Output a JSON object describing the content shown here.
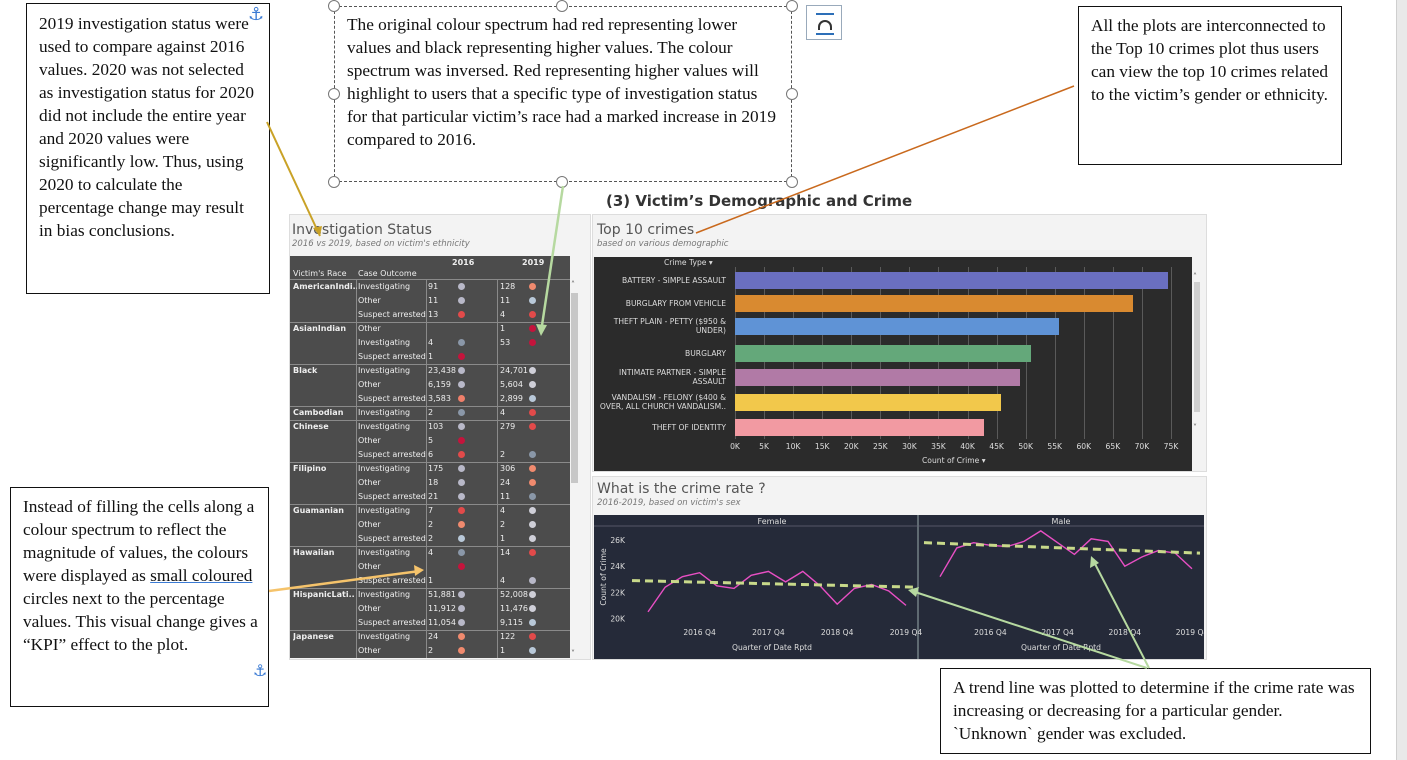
{
  "callouts": {
    "left": "2019 investigation status were used to compare against 2016 values. 2020 was not selected as investigation status for 2020 did not include the entire year and 2020 values were significantly low. Thus, using 2020 to calculate the percentage change may result in bias conclusions.",
    "center": "The original colour spectrum had red representing lower values and black representing higher values. The colour spectrum was inversed. Red representing higher values will highlight to users that a specific type of investigation status for that particular victim’s race had a marked increase in 2019 compared to 2016.",
    "right": "All the plots are interconnected to the Top 10 crimes plot thus users can view the top 10 crimes related to the victim’s gender or ethnicity.",
    "bottom_left_pre": "Instead of filling the cells along a colour spectrum to reflect the magnitude of values, the colours were displayed as ",
    "bottom_left_link": "small coloured",
    "bottom_left_post": " circles next to the percentage values. This visual change gives a “KPI” effect to the plot.",
    "bottom_right": "A trend line was plotted to determine if the crime rate was increasing or decreasing for a particular gender. `Unknown` gender was excluded."
  },
  "section_title": "(3) Victim’s Demographic and Crime",
  "investigation": {
    "title": "Investigation Status",
    "subtitle": "2016 vs 2019, based on victim's ethnicity",
    "col_race": "Victim's Race",
    "col_outcome": "Case Outcome",
    "col_2016": "2016",
    "col_2019": "2019",
    "rows": [
      {
        "race": "AmericanIndi..",
        "outcome": "Investigating",
        "v16": "91",
        "c16": "#b8b8c8",
        "v19": "128",
        "c19": "#f08a6e"
      },
      {
        "race": "",
        "outcome": "Other",
        "v16": "11",
        "c16": "#b8b8c8",
        "v19": "11",
        "c19": "#b8c8d8"
      },
      {
        "race": "",
        "outcome": "Suspect arrested",
        "v16": "13",
        "c16": "#e24a4a",
        "v19": "4",
        "c19": "#e24a4a"
      },
      {
        "race": "AsianIndian",
        "outcome": "Other",
        "v16": "",
        "c16": "",
        "v19": "1",
        "c19": "#c4143c"
      },
      {
        "race": "",
        "outcome": "Investigating",
        "v16": "4",
        "c16": "#8a97a8",
        "v19": "53",
        "c19": "#c4143c"
      },
      {
        "race": "",
        "outcome": "Suspect arrested",
        "v16": "1",
        "c16": "#c4143c",
        "v19": "",
        "c19": ""
      },
      {
        "race": "Black",
        "outcome": "Investigating",
        "v16": "23,438",
        "c16": "#b8b8c8",
        "v19": "24,701",
        "c19": "#cfcfd8"
      },
      {
        "race": "",
        "outcome": "Other",
        "v16": "6,159",
        "c16": "#b8b8c8",
        "v19": "5,604",
        "c19": "#cfcfd8"
      },
      {
        "race": "",
        "outcome": "Suspect arrested",
        "v16": "3,583",
        "c16": "#ef7f6a",
        "v19": "2,899",
        "c19": "#b8c8d8"
      },
      {
        "race": "Cambodian",
        "outcome": "Investigating",
        "v16": "2",
        "c16": "#8a97a8",
        "v19": "4",
        "c19": "#e24a4a"
      },
      {
        "race": "Chinese",
        "outcome": "Investigating",
        "v16": "103",
        "c16": "#b8b8c8",
        "v19": "279",
        "c19": "#e24a4a"
      },
      {
        "race": "",
        "outcome": "Other",
        "v16": "5",
        "c16": "#c4143c",
        "v19": "",
        "c19": ""
      },
      {
        "race": "",
        "outcome": "Suspect arrested",
        "v16": "6",
        "c16": "#e24a4a",
        "v19": "2",
        "c19": "#8a97a8"
      },
      {
        "race": "Filipino",
        "outcome": "Investigating",
        "v16": "175",
        "c16": "#b8b8c8",
        "v19": "306",
        "c19": "#f08a6e"
      },
      {
        "race": "",
        "outcome": "Other",
        "v16": "18",
        "c16": "#b8b8c8",
        "v19": "24",
        "c19": "#f08a6e"
      },
      {
        "race": "",
        "outcome": "Suspect arrested",
        "v16": "21",
        "c16": "#b8b8c8",
        "v19": "11",
        "c19": "#8a97a8"
      },
      {
        "race": "Guamanian",
        "outcome": "Investigating",
        "v16": "7",
        "c16": "#e24a4a",
        "v19": "4",
        "c19": "#cfcfd8"
      },
      {
        "race": "",
        "outcome": "Other",
        "v16": "2",
        "c16": "#f08a6e",
        "v19": "2",
        "c19": "#cfcfd8"
      },
      {
        "race": "",
        "outcome": "Suspect arrested",
        "v16": "2",
        "c16": "#b8c8d8",
        "v19": "1",
        "c19": "#cfcfd8"
      },
      {
        "race": "Hawaiian",
        "outcome": "Investigating",
        "v16": "4",
        "c16": "#8a97a8",
        "v19": "14",
        "c19": "#e24a4a"
      },
      {
        "race": "",
        "outcome": "Other",
        "v16": "",
        "c16": "#c4143c",
        "v19": "",
        "c19": ""
      },
      {
        "race": "",
        "outcome": "Suspect arrested",
        "v16": "1",
        "c16": "",
        "v19": "4",
        "c19": "#b8b8c8"
      },
      {
        "race": "HispanicLati..",
        "outcome": "Investigating",
        "v16": "51,881",
        "c16": "#b8b8c8",
        "v19": "52,008",
        "c19": "#cfcfd8"
      },
      {
        "race": "",
        "outcome": "Other",
        "v16": "11,912",
        "c16": "#b8b8c8",
        "v19": "11,476",
        "c19": "#cfcfd8"
      },
      {
        "race": "",
        "outcome": "Suspect arrested",
        "v16": "11,054",
        "c16": "#b8b8c8",
        "v19": "9,115",
        "c19": "#b8c8d8"
      },
      {
        "race": "Japanese",
        "outcome": "Investigating",
        "v16": "24",
        "c16": "#f08a6e",
        "v19": "122",
        "c19": "#e24a4a"
      },
      {
        "race": "",
        "outcome": "Other",
        "v16": "2",
        "c16": "#f08a6e",
        "v19": "1",
        "c19": "#b8c8d8"
      }
    ]
  },
  "top10": {
    "title": "Top 10 crimes",
    "subtitle": "based on various demographic",
    "header": "Crime Type",
    "xlabel": "Count of Crime",
    "chart_data": {
      "type": "bar",
      "categories": [
        "BATTERY - SIMPLE ASSAULT",
        "BURGLARY FROM VEHICLE",
        "THEFT PLAIN - PETTY ($950 & UNDER)",
        "BURGLARY",
        "INTIMATE PARTNER - SIMPLE ASSAULT",
        "VANDALISM - FELONY ($400 & OVER, ALL CHURCH VANDALISM..",
        "THEFT OF IDENTITY"
      ],
      "values": [
        74500,
        68500,
        55800,
        51000,
        49000,
        45800,
        42800
      ],
      "colors": [
        "#6a6fc0",
        "#d98a30",
        "#5f93d6",
        "#64a87a",
        "#b17aa6",
        "#f2c84b",
        "#f29aa2"
      ],
      "ticks": [
        "0K",
        "5K",
        "10K",
        "15K",
        "20K",
        "25K",
        "30K",
        "35K",
        "40K",
        "45K",
        "50K",
        "55K",
        "60K",
        "65K",
        "70K",
        "75K"
      ],
      "xlim": [
        0,
        75000
      ]
    }
  },
  "rate": {
    "title": "What is the crime rate ?",
    "subtitle": "2016-2019, based on victim's sex",
    "ylabel": "Count of Crime",
    "xlabel": "Quarter of Date Rptd",
    "chart_data": {
      "type": "line",
      "panels": [
        "Female",
        "Male"
      ],
      "x": [
        "2016 Q1",
        "2016 Q2",
        "2016 Q3",
        "2016 Q4",
        "2017 Q1",
        "2017 Q2",
        "2017 Q3",
        "2017 Q4",
        "2018 Q1",
        "2018 Q2",
        "2018 Q3",
        "2018 Q4",
        "2019 Q1",
        "2019 Q2",
        "2019 Q3",
        "2019 Q4"
      ],
      "x_ticks": [
        "2016 Q4",
        "2017 Q4",
        "2018 Q4",
        "2019 Q4"
      ],
      "y_ticks": [
        "20K",
        "22K",
        "24K",
        "26K"
      ],
      "ylim": [
        19500,
        27000
      ],
      "series": [
        {
          "name": "Female",
          "values": [
            20500,
            22400,
            23200,
            23500,
            22500,
            22300,
            23300,
            23600,
            22800,
            23600,
            22500,
            21100,
            22300,
            22600,
            22100,
            21000
          ],
          "trend": [
            22900,
            22400
          ]
        },
        {
          "name": "Male",
          "values": [
            23200,
            25400,
            25800,
            25600,
            25500,
            25900,
            26700,
            25800,
            24900,
            26100,
            25900,
            24000,
            24700,
            25200,
            25000,
            23800
          ],
          "trend": [
            25800,
            25000
          ]
        }
      ],
      "line_color": "#e84fc4",
      "trend_color": "#c8d98a"
    }
  }
}
